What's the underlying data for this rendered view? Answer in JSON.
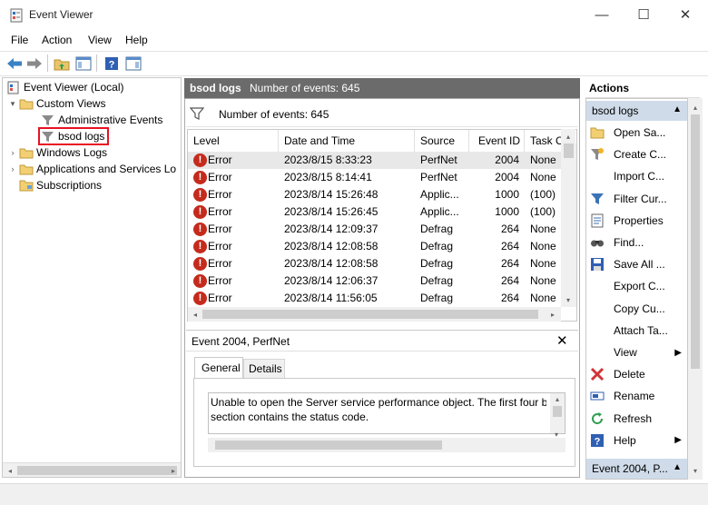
{
  "window": {
    "title": "Event Viewer",
    "minimize": "—",
    "maximize": "☐",
    "close": "✕"
  },
  "menu": [
    "File",
    "Action",
    "View",
    "Help"
  ],
  "tree": {
    "root": "Event Viewer (Local)",
    "custom_views": "Custom Views",
    "administrative_events": "Administrative Events",
    "bsod_logs": "bsod logs",
    "windows_logs": "Windows Logs",
    "apps_services": "Applications and Services Lo",
    "subscriptions": "Subscriptions"
  },
  "middle": {
    "header_title": "bsod logs",
    "header_count": "Number of events: 645",
    "filter_count": "Number of events: 645",
    "columns": [
      "Level",
      "Date and Time",
      "Source",
      "Event ID",
      "Task C"
    ],
    "rows": [
      {
        "level": "Error",
        "datetime": "2023/8/15 8:33:23",
        "source": "PerfNet",
        "event_id": "2004",
        "task": "None"
      },
      {
        "level": "Error",
        "datetime": "2023/8/15 8:14:41",
        "source": "PerfNet",
        "event_id": "2004",
        "task": "None"
      },
      {
        "level": "Error",
        "datetime": "2023/8/14 15:26:48",
        "source": "Applic...",
        "event_id": "1000",
        "task": "(100)"
      },
      {
        "level": "Error",
        "datetime": "2023/8/14 15:26:45",
        "source": "Applic...",
        "event_id": "1000",
        "task": "(100)"
      },
      {
        "level": "Error",
        "datetime": "2023/8/14 12:09:37",
        "source": "Defrag",
        "event_id": "264",
        "task": "None"
      },
      {
        "level": "Error",
        "datetime": "2023/8/14 12:08:58",
        "source": "Defrag",
        "event_id": "264",
        "task": "None"
      },
      {
        "level": "Error",
        "datetime": "2023/8/14 12:08:58",
        "source": "Defrag",
        "event_id": "264",
        "task": "None"
      },
      {
        "level": "Error",
        "datetime": "2023/8/14 12:06:37",
        "source": "Defrag",
        "event_id": "264",
        "task": "None"
      },
      {
        "level": "Error",
        "datetime": "2023/8/14 11:56:05",
        "source": "Defrag",
        "event_id": "264",
        "task": "None"
      }
    ],
    "detail_title": "Event 2004, PerfNet",
    "tabs": [
      "General",
      "Details"
    ],
    "description_line1": "Unable to open the Server service performance object. The first four byt",
    "description_line2": "section contains the status code."
  },
  "actions": {
    "header": "Actions",
    "section1": "bsod logs",
    "items": [
      "Open Sa...",
      "Create C...",
      "Import C...",
      "Filter Cur...",
      "Properties",
      "Find...",
      "Save All ...",
      "Export C...",
      "Copy Cu...",
      "Attach Ta...",
      "View",
      "Delete",
      "Rename",
      "Refresh",
      "Help"
    ],
    "section2": "Event 2004, P..."
  },
  "colors": {
    "accent_header": "#6b6b6b",
    "section_bg": "#cfdbe9",
    "error_red": "#c42b1c",
    "highlight_red": "#e81123"
  }
}
